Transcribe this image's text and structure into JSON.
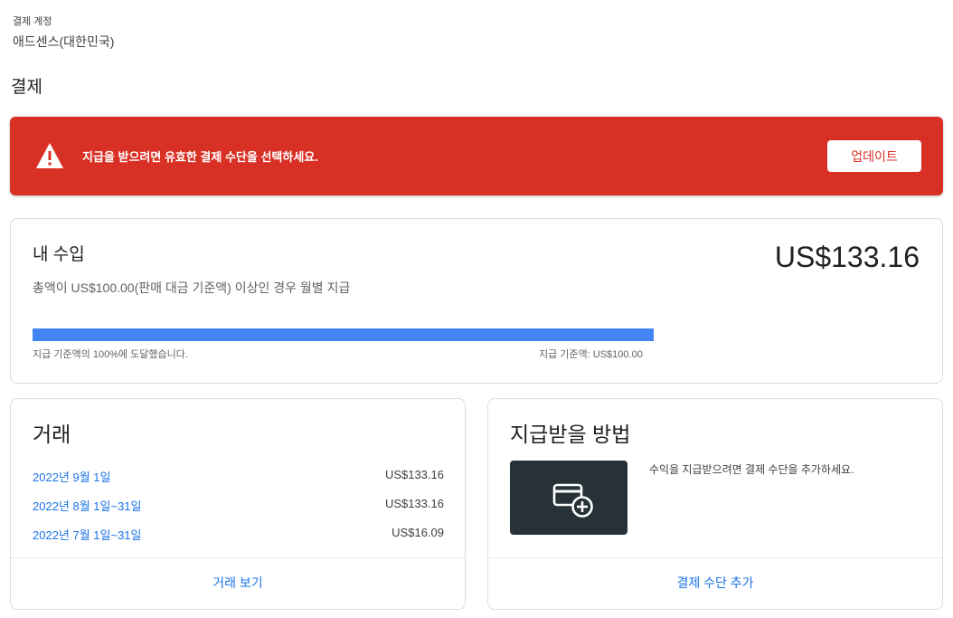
{
  "account": {
    "label": "결제 계정",
    "name": "애드센스(대한민국)"
  },
  "page": {
    "title": "결제"
  },
  "alert": {
    "message": "지급을 받으려면 유효한 결제 수단을 선택하세요.",
    "button_label": "업데이트",
    "color": "#d93025"
  },
  "earnings": {
    "title": "내 수입",
    "description": "총액이 US$100.00(판매 대금 기준액) 이상인 경우 월별 지급",
    "amount": "US$133.16",
    "progress_percent": 100,
    "progress_text": "지급 기준액의 100%에 도달했습니다.",
    "threshold_text": "지급 기준액: US$100.00"
  },
  "transactions": {
    "title": "거래",
    "rows": [
      {
        "date": "2022년 9월 1일",
        "amount": "US$133.16"
      },
      {
        "date": "2022년 8월 1일~31일",
        "amount": "US$133.16"
      },
      {
        "date": "2022년 7월 1일~31일",
        "amount": "US$16.09"
      }
    ],
    "link_label": "거래 보기"
  },
  "payment_method": {
    "title": "지급받을 방법",
    "icon": "add-card-icon",
    "description": "수익을 지급받으려면 결제 수단을 추가하세요.",
    "link_label": "결제 수단 추가"
  }
}
